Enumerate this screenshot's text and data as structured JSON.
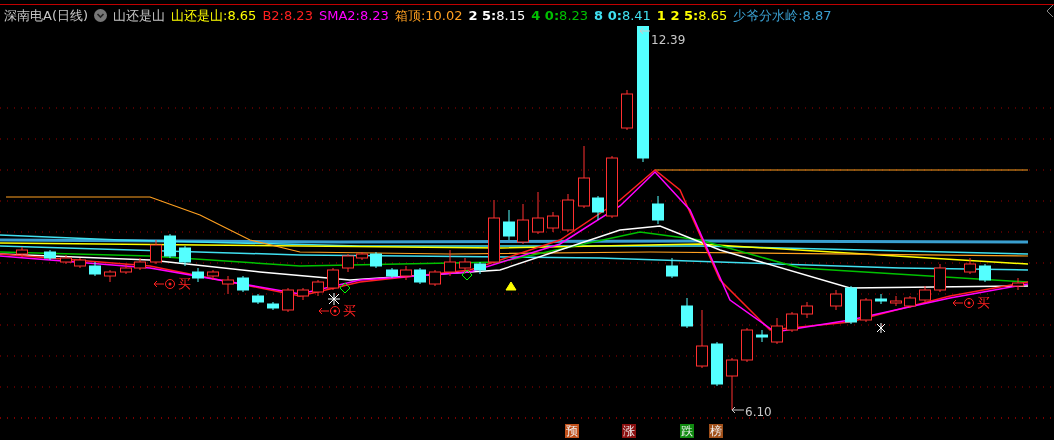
{
  "window": {
    "title": "深南电A(日线)"
  },
  "indicator": {
    "name": "山还是山"
  },
  "legend": [
    {
      "label": "山还是山:",
      "value": "8.65",
      "color": "#ffff00",
      "kind": "plain"
    },
    {
      "label": "B2:",
      "value": "8.23",
      "color": "#ff2020",
      "kind": "plain"
    },
    {
      "label": "SMA2:",
      "value": "8.23",
      "color": "#ff00ff",
      "kind": "plain"
    },
    {
      "label": "箱顶:",
      "value": "10.02",
      "color": "#ffa020",
      "kind": "plain"
    },
    {
      "label": "2 5:",
      "value": "8.15",
      "color": "#ffffff",
      "kind": "period"
    },
    {
      "label": "4 0:",
      "value": "8.23",
      "color": "#00c000",
      "kind": "period"
    },
    {
      "label": "8 0:",
      "value": "8.41",
      "color": "#40e0f0",
      "kind": "period"
    },
    {
      "label": "1 2 5:",
      "value": "8.65",
      "color": "#ffff00",
      "kind": "period"
    },
    {
      "label": "少爷分水岭:",
      "value": "8.87",
      "color": "#3a9fd0",
      "kind": "plain"
    }
  ],
  "price_labels": [
    {
      "text": "12.39",
      "kind": "high"
    },
    {
      "text": "6.10",
      "kind": "low"
    }
  ],
  "signals": [
    {
      "text": "买"
    },
    {
      "text": "买"
    },
    {
      "text": "买"
    }
  ],
  "bottom_tags": [
    {
      "text": "预",
      "color": "#c0501a"
    },
    {
      "text": "涨",
      "color": "#8a1010"
    },
    {
      "text": "跌",
      "color": "#108a10"
    },
    {
      "text": "榜",
      "color": "#a0501a"
    }
  ]
}
